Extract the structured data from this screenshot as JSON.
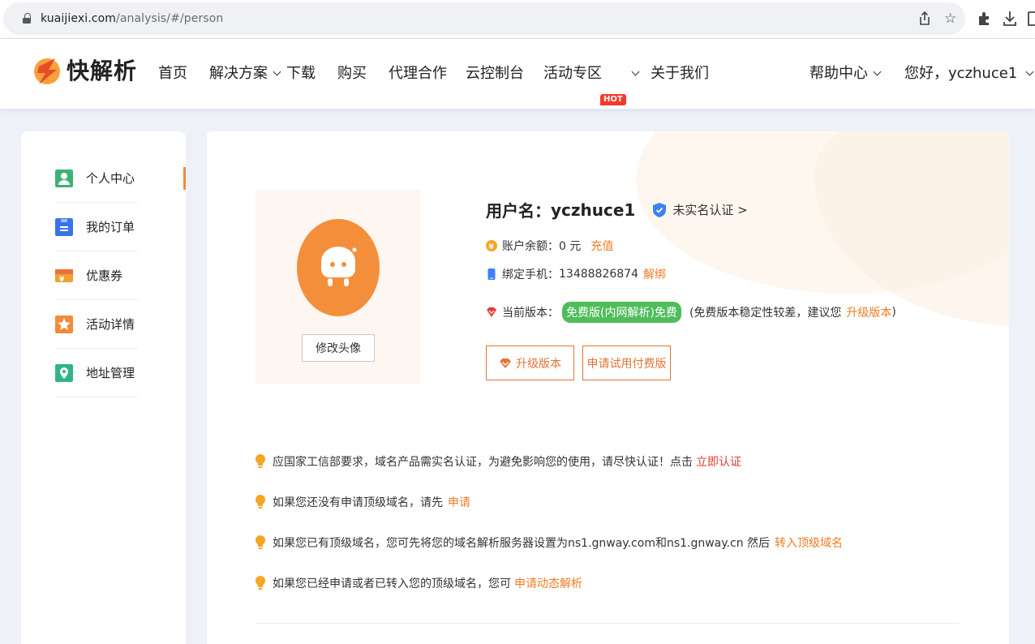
{
  "browser": {
    "url_host": "kuaijiexi.com",
    "url_path": "/analysis/#/person"
  },
  "header": {
    "logo_text": "快解析",
    "nav": [
      {
        "label": "首页",
        "dropdown": false
      },
      {
        "label": "解决方案",
        "dropdown": true
      },
      {
        "label": "下载",
        "dropdown": false
      },
      {
        "label": "购买",
        "dropdown": false
      },
      {
        "label": "代理合作",
        "dropdown": false
      },
      {
        "label": "云控制台",
        "dropdown": false
      },
      {
        "label": "活动专区",
        "dropdown": true,
        "badge": "HOT"
      },
      {
        "label": "关于我们",
        "dropdown": false
      }
    ],
    "help": "帮助中心",
    "greeting": "您好，yczhuce1"
  },
  "sidebar": {
    "items": [
      {
        "label": "个人中心",
        "icon": "person-icon",
        "active": true
      },
      {
        "label": "我的订单",
        "icon": "order-icon",
        "active": false
      },
      {
        "label": "优惠券",
        "icon": "coupon-icon",
        "active": false
      },
      {
        "label": "活动详情",
        "icon": "star-icon",
        "active": false
      },
      {
        "label": "地址管理",
        "icon": "location-icon",
        "active": false
      }
    ]
  },
  "profile": {
    "change_avatar": "修改头像",
    "username_label": "用户名：",
    "username": "yczhuce1",
    "verify_status": "未实名认证 >",
    "balance_label": "账户余额：",
    "balance_value": "0 元",
    "recharge": "充值",
    "phone_label": "绑定手机：",
    "phone_value": "13488826874",
    "unbind": "解绑",
    "version_label": "当前版本：",
    "version_badge": "免费版(内网解析)免费",
    "version_note_open": "(免费版本稳定性较差，建议您",
    "upgrade_link": "升级版本",
    "version_note_close": ")",
    "upgrade_button": "升级版本",
    "trial_button": "申请试用付费版"
  },
  "tips": [
    {
      "text": "应国家工信部要求，域名产品需实名认证，为避免影响您的使用，请尽快认证！点击",
      "link": "立即认证",
      "link_color": "red"
    },
    {
      "text": "如果您还没有申请顶级域名，请先",
      "link": "申请",
      "link_color": "orange"
    },
    {
      "text": "如果您已有顶级域名，您可先将您的域名解析服务器设置为ns1.gnway.com和ns1.gnway.cn 然后",
      "link": "转入顶级域名",
      "link_color": "orange"
    },
    {
      "text": "如果您已经申请或者已转入您的顶级域名，您可",
      "link": "申请动态解析",
      "link_color": "orange"
    }
  ],
  "colors": {
    "accent": "#f07b24",
    "link_red": "#e43a2e",
    "badge_green": "#4fbd5a"
  }
}
